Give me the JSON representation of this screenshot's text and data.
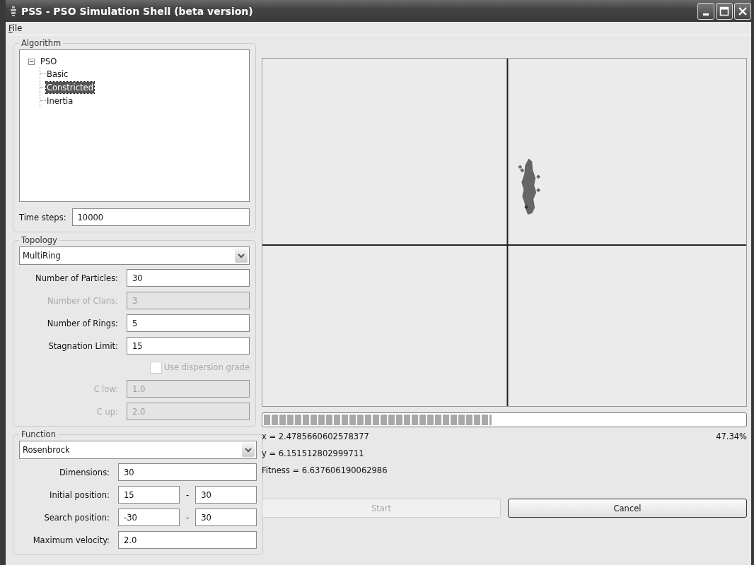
{
  "window": {
    "title": "PSS - PSO Simulation Shell (beta version)"
  },
  "menu": [
    {
      "label": "File"
    }
  ],
  "algorithm": {
    "title": "Algorithm",
    "tree": [
      {
        "label": "PSO",
        "expanded": true,
        "selected": false,
        "children": [
          {
            "label": "Basic",
            "selected": false
          },
          {
            "label": "Constricted",
            "selected": true
          },
          {
            "label": "Inertia",
            "selected": false
          }
        ]
      }
    ],
    "time_steps": {
      "label": "Time steps:",
      "value": "10000"
    }
  },
  "topology": {
    "title": "Topology",
    "dropdown": "MultiRing",
    "fields": [
      {
        "kind": "field",
        "label": "Number of Particles:",
        "value": "30",
        "disabled": false
      },
      {
        "kind": "field",
        "label": "Number of Clans:",
        "value": "3",
        "disabled": true
      },
      {
        "kind": "field",
        "label": "Number of Rings:",
        "value": "5",
        "disabled": false
      },
      {
        "kind": "field",
        "label": "Stagnation Limit:",
        "value": "15",
        "disabled": false
      },
      {
        "kind": "checkbox",
        "label": "Use dispersion grade",
        "checked": false,
        "disabled": true
      },
      {
        "kind": "field",
        "label": "C low:",
        "value": "1.0",
        "disabled": true
      },
      {
        "kind": "field",
        "label": "C up:",
        "value": "2.0",
        "disabled": true
      }
    ]
  },
  "function": {
    "title": "Function",
    "dropdown": "Rosenbrock",
    "fields": [
      {
        "kind": "field",
        "label": "Dimensions:",
        "value": "30"
      },
      {
        "kind": "range",
        "label": "Initial position:",
        "from": "15",
        "separator": "-",
        "to": "30"
      },
      {
        "kind": "range",
        "label": "Search position:",
        "from": "-30",
        "separator": "-",
        "to": "30"
      },
      {
        "kind": "field",
        "label": "Maximum velocity:",
        "value": "2.0"
      }
    ]
  },
  "progress": {
    "level": 0.4734,
    "reading": "47.34%"
  },
  "readouts": [
    "x = 2.4785660602578377",
    "y = 6.151512802999711",
    "Fitness = 6.637606190062986"
  ],
  "buttons": [
    {
      "label": "Start",
      "disabled": true
    },
    {
      "label": "Cancel",
      "disabled": false
    }
  ]
}
